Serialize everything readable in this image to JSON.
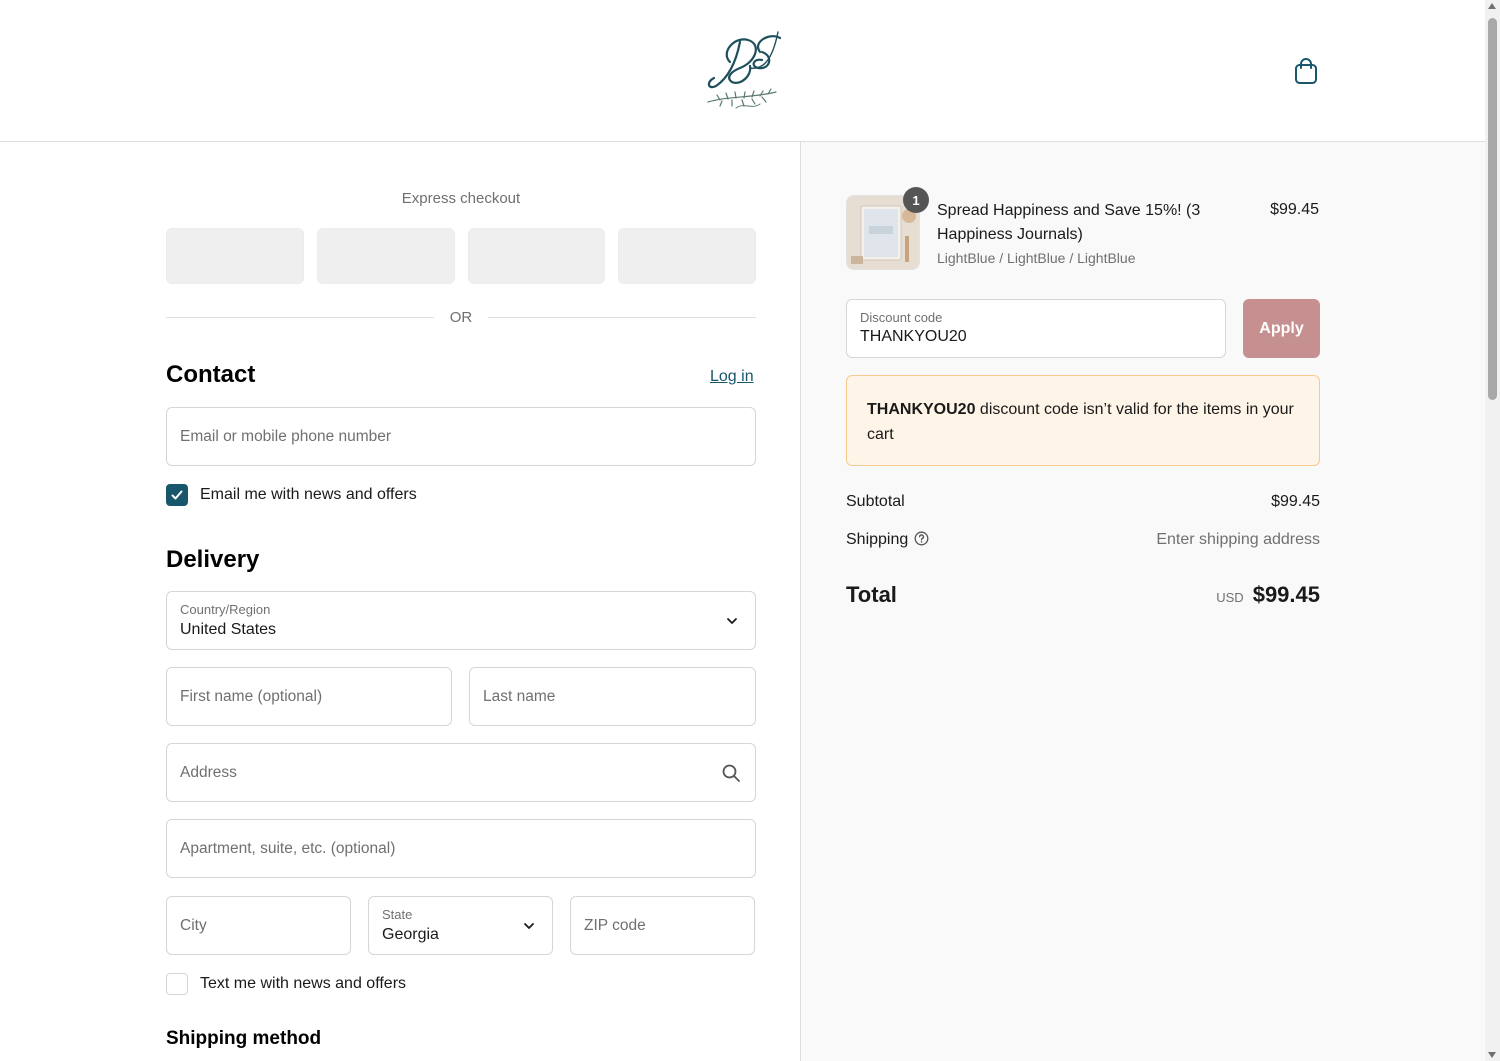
{
  "header": {
    "logo_alt": "BS",
    "cart_icon": "shopping-bag-icon"
  },
  "express": {
    "title": "Express checkout",
    "or": "OR"
  },
  "contact": {
    "title": "Contact",
    "login_label": "Log in",
    "email_placeholder": "Email or mobile phone number",
    "news_checkbox_label": "Email me with news and offers",
    "news_checked": true
  },
  "delivery": {
    "title": "Delivery",
    "country_label": "Country/Region",
    "country_value": "United States",
    "first_name_placeholder": "First name (optional)",
    "last_name_placeholder": "Last name",
    "address_placeholder": "Address",
    "apartment_placeholder": "Apartment, suite, etc. (optional)",
    "city_placeholder": "City",
    "state_label": "State",
    "state_value": "Georgia",
    "zip_placeholder": "ZIP code",
    "text_checkbox_label": "Text me with news and offers",
    "text_checked": false
  },
  "shipping_method": {
    "title": "Shipping method"
  },
  "order": {
    "quantity": "1",
    "product_name": "Spread Happiness and Save 15%! (3 Happiness Journals)",
    "variant": "LightBlue / LightBlue / LightBlue",
    "price": "$99.45",
    "discount_label": "Discount code",
    "discount_value": "THANKYOU20",
    "apply_label": "Apply",
    "alert_code": "THANKYOU20",
    "alert_message": " discount code isn’t valid for the items in your cart",
    "subtotal_label": "Subtotal",
    "subtotal_value": "$99.45",
    "shipping_label": "Shipping",
    "shipping_value": "Enter shipping address",
    "total_label": "Total",
    "total_currency": "USD",
    "total_value": "$99.45"
  },
  "colors": {
    "accent": "#17566b",
    "apply_button": "#c79090",
    "alert_bg": "#fff4e8",
    "alert_border": "#f6c98e"
  }
}
